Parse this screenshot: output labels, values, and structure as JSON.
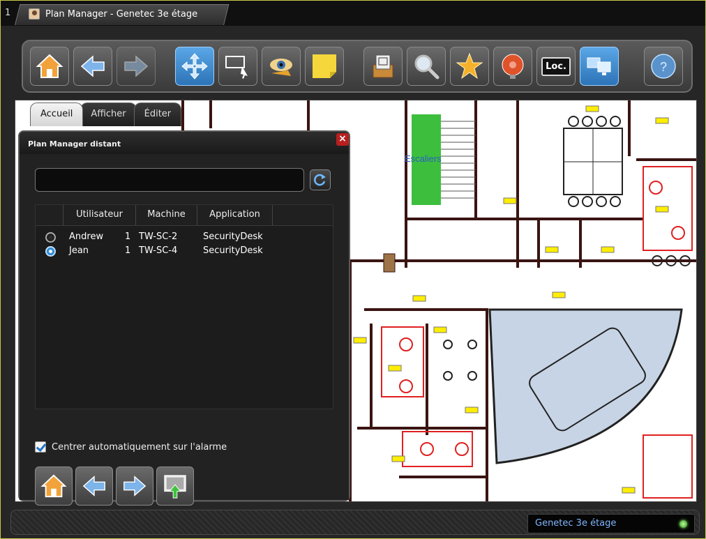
{
  "window": {
    "tab_number": "1",
    "title": "Plan Manager - Genetec 3e étage"
  },
  "toolbar": {
    "buttons": [
      {
        "name": "home",
        "icon": "home-icon"
      },
      {
        "name": "back",
        "icon": "arrow-left-icon"
      },
      {
        "name": "forward",
        "icon": "arrow-right-icon"
      },
      {
        "name": "pan",
        "icon": "move-icon",
        "active": true
      },
      {
        "name": "select",
        "icon": "rectangle-select-icon"
      },
      {
        "name": "visibility",
        "icon": "eye-icon"
      },
      {
        "name": "notes",
        "icon": "sticky-note-icon"
      },
      {
        "name": "archive",
        "icon": "archive-icon"
      },
      {
        "name": "search",
        "icon": "magnifier-icon"
      },
      {
        "name": "favorites",
        "icon": "star-icon"
      },
      {
        "name": "alarm",
        "icon": "alarm-bell-icon"
      },
      {
        "name": "locate",
        "icon": "loc-monitor-icon",
        "label": "Loc."
      },
      {
        "name": "remote-monitors",
        "icon": "monitors-icon",
        "active": true
      },
      {
        "name": "help",
        "icon": "help-icon"
      }
    ]
  },
  "view_tabs": [
    "Accueil",
    "Afficher",
    "Éditer"
  ],
  "map": {
    "label": "Escaliers"
  },
  "remote_panel": {
    "title": "Plan Manager distant",
    "search_value": "",
    "table": {
      "columns": [
        "Utilisateur",
        "Machine",
        "Application"
      ],
      "rows": [
        {
          "user": "Andrew",
          "id": "1",
          "machine": "TW-SC-2",
          "application": "SecurityDesk",
          "selected": false
        },
        {
          "user": "Jean",
          "id": "1",
          "machine": "TW-SC-4",
          "application": "SecurityDesk",
          "selected": true
        }
      ]
    },
    "auto_center_label": "Centrer automatiquement sur l'alarme",
    "auto_center_checked": true
  },
  "status": {
    "floor": "Genetec 3e étage"
  },
  "colors": {
    "frame_accent": "#c9c94a",
    "active_blue": "#2d74b7",
    "selected_zone": "#c7d4e5",
    "walls": "#3a1412",
    "furniture_red": "#e02020",
    "stairs_green": "#3dbf3d"
  }
}
